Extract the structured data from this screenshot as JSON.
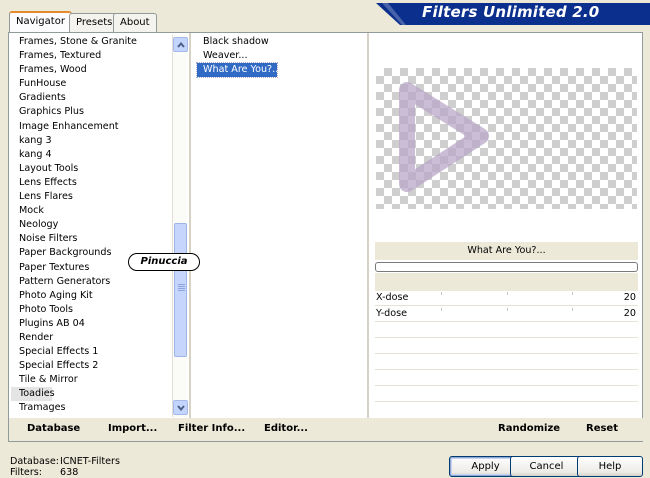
{
  "tabs": [
    "Navigator",
    "Presets",
    "About"
  ],
  "banner_title": "Filters Unlimited 2.0",
  "categories": [
    "Frames, Stone & Granite",
    "Frames, Textured",
    "Frames, Wood",
    "FunHouse",
    "Gradients",
    "Graphics Plus",
    "Image Enhancement",
    "kang 3",
    "kang 4",
    "Layout Tools",
    "Lens Effects",
    "Lens Flares",
    "Mock",
    "Neology",
    "Noise Filters",
    "Paper Backgrounds",
    "Paper Textures",
    "Pattern Generators",
    "Photo Aging Kit",
    "Photo Tools",
    "Plugins AB 04",
    "Render",
    "Special Effects 1",
    "Special Effects 2",
    "Tile & Mirror",
    "Toadies",
    "Tramages"
  ],
  "selected_category": "Toadies",
  "filters": [
    "Black shadow",
    "Weaver...",
    "What Are You?..."
  ],
  "selected_filter": "What Are You?...",
  "preview": {
    "filter_name": "What Are You?..."
  },
  "params": [
    {
      "label": "X-dose",
      "value": "20"
    },
    {
      "label": "Y-dose",
      "value": "20"
    }
  ],
  "toolbar": {
    "database_label": "Database",
    "import_label": "Import...",
    "filter_info_label": "Filter Info...",
    "editor_label": "Editor...",
    "randomize_label": "Randomize",
    "reset_label": "Reset"
  },
  "status": {
    "database_label": "Database:",
    "database_value": "ICNET-Filters",
    "filters_label": "Filters:",
    "filters_value": "638"
  },
  "buttons": {
    "apply": "Apply",
    "cancel": "Cancel",
    "help": "Help"
  },
  "watermark": "Pinuccia",
  "colors": {
    "banner": "#0b2f8c",
    "selection": "#316ac5",
    "tab_accent": "#e68b2c"
  }
}
